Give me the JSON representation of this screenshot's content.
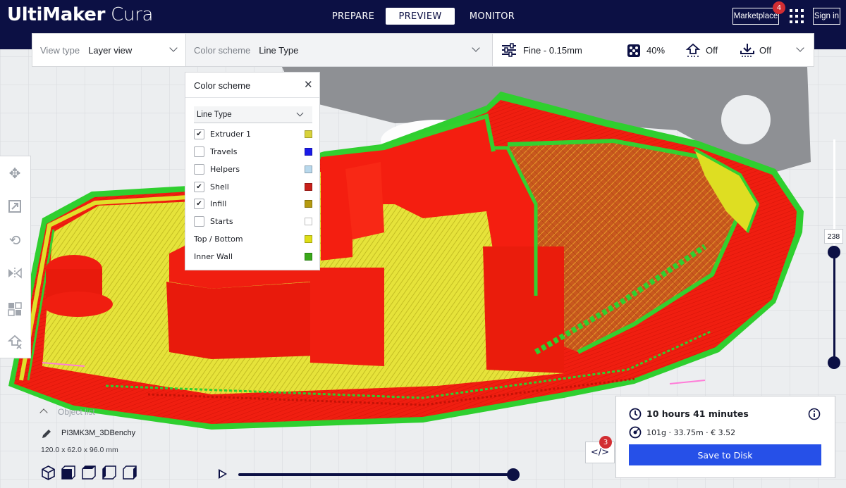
{
  "app": {
    "logo_bold": "UltiMaker",
    "logo_light": " Cura"
  },
  "header": {
    "tabs": [
      {
        "label": "PREPARE",
        "active": false
      },
      {
        "label": "PREVIEW",
        "active": true
      },
      {
        "label": "MONITOR",
        "active": false
      }
    ],
    "marketplace_label": "Marketplace",
    "marketplace_badge": "4",
    "apps_icon": "grid-icon",
    "signin_label": "Sign in"
  },
  "topbar": {
    "view_type_label": "View type",
    "view_type_value": "Layer view",
    "color_scheme_label": "Color scheme",
    "color_scheme_value": "Line Type",
    "profile": "Fine - 0.15mm",
    "infill": "40%",
    "support": "Off",
    "adhesion": "Off"
  },
  "color_scheme_panel": {
    "title": "Color scheme",
    "close_icon": "close-icon",
    "selected": "Line Type",
    "items": [
      {
        "label": "Extruder 1",
        "checked": true,
        "color": "#d8d23a"
      },
      {
        "label": "Travels",
        "checked": false,
        "color": "#1a1ae8"
      },
      {
        "label": "Helpers",
        "checked": false,
        "color": "#b8d8ec"
      },
      {
        "label": "Shell",
        "checked": true,
        "color": "#c8201b"
      },
      {
        "label": "Infill",
        "checked": true,
        "color": "#b59a10"
      },
      {
        "label": "Starts",
        "checked": false,
        "color": "#ffffff"
      },
      {
        "label": "Top / Bottom",
        "checked": null,
        "color": "#dede16"
      },
      {
        "label": "Inner Wall",
        "checked": null,
        "color": "#3aa81a"
      }
    ]
  },
  "left_tools": [
    "move-icon",
    "scale-icon",
    "rotate-icon",
    "mirror-icon",
    "per-model-settings-icon",
    "support-blocker-icon"
  ],
  "layer_slider": {
    "current_layer": "238"
  },
  "object": {
    "label": "Object list",
    "name": "PI3MK3M_3DBenchy",
    "dimensions": "120.0 x 62.0 x 96.0 mm"
  },
  "view_buttons": [
    "3d-view-icon",
    "front-view-icon",
    "top-view-icon",
    "left-view-icon",
    "right-view-icon"
  ],
  "print": {
    "time": "10 hours 41 minutes",
    "material": "101g · 33.75m · € 3.52",
    "save_label": "Save to Disk",
    "code_badge": "3"
  }
}
